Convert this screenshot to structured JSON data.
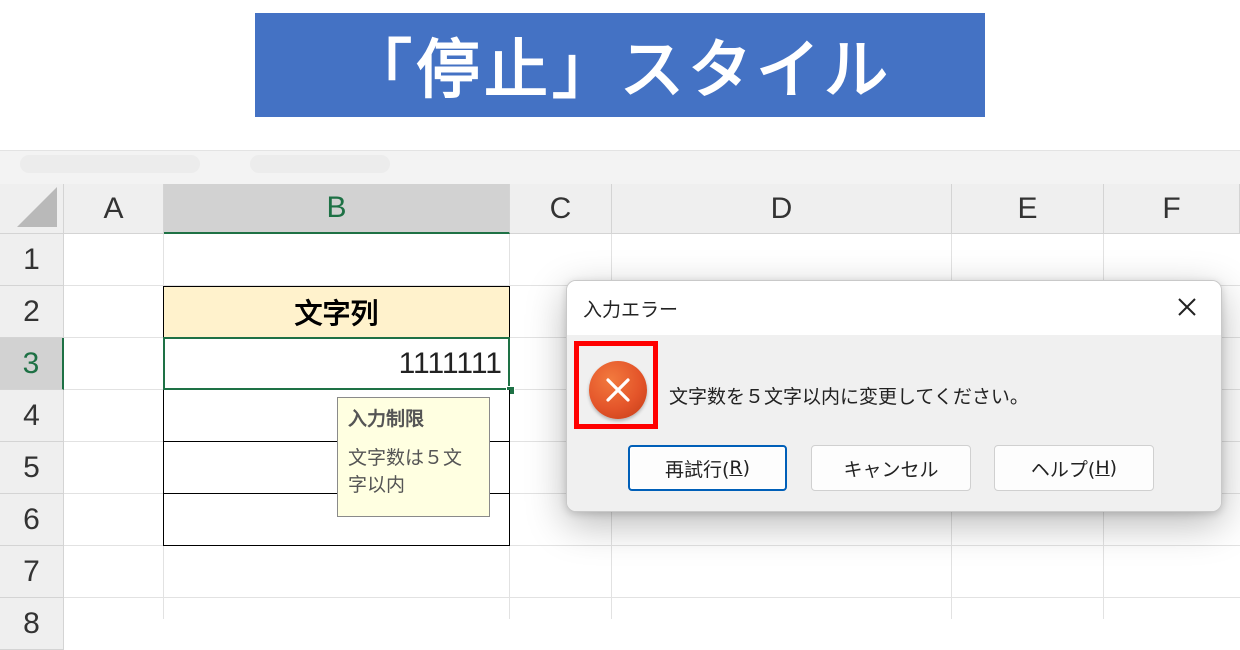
{
  "banner": {
    "title": "「停止」スタイル"
  },
  "sheet": {
    "columns": [
      "A",
      "B",
      "C",
      "D",
      "E",
      "F"
    ],
    "rows": [
      "1",
      "2",
      "3",
      "4",
      "5",
      "6",
      "7",
      "8"
    ],
    "selected_column": "B",
    "selected_row": "3",
    "header_cell": "文字列",
    "active_cell_value": "1111111"
  },
  "input_tooltip": {
    "title": "入力制限",
    "body_line1": "文字数は５文",
    "body_line2": "字以内"
  },
  "dialog": {
    "title": "入力エラー",
    "close_icon": "close-icon",
    "error_icon": "error-x-circle-icon",
    "message": "文字数を５文字以内に変更してください。",
    "buttons": {
      "retry_text": "再試行(",
      "retry_key": "R",
      "retry_end": ")",
      "cancel": "キャンセル",
      "help_text": "ヘルプ(",
      "help_key": "H",
      "help_end": ")"
    }
  },
  "colors": {
    "banner": "#4472c4",
    "excel_green": "#1e7145",
    "header_fill": "#fff2cc",
    "error_orange": "#e4552a",
    "highlight_red": "#ff0000"
  }
}
